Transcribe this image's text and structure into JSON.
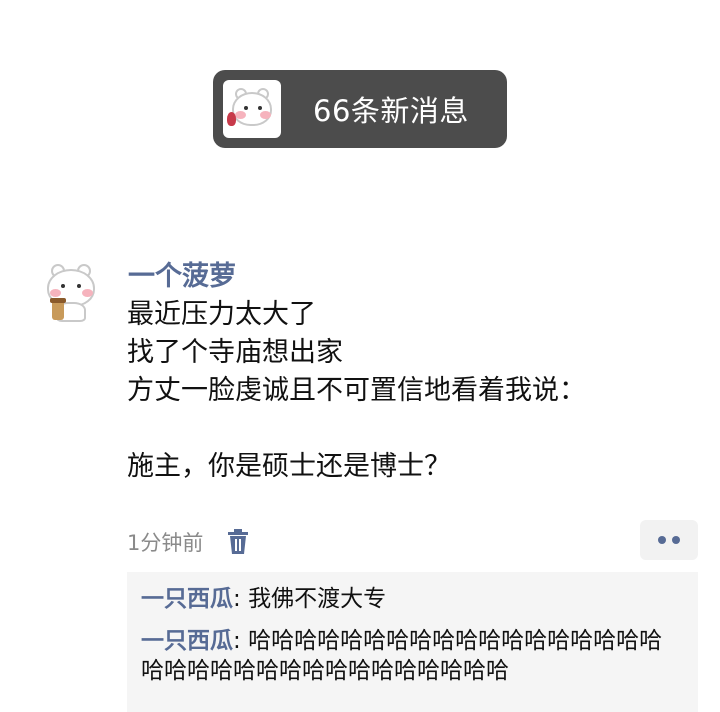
{
  "notification": {
    "text": "66条新消息"
  },
  "post": {
    "username": "一个菠萝",
    "content": "最近压力太大了\n找了个寺庙想出家\n方丈一脸虔诚且不可置信地看着我说：\n\n施主，你是硕士还是博士？",
    "time": "1分钟前",
    "more_icon": "two-dots-icon",
    "delete_icon": "trash-icon"
  },
  "comments": [
    {
      "author": "一只西瓜",
      "separator": ": ",
      "text": "我佛不渡大专"
    },
    {
      "author": "一只西瓜",
      "separator": ": ",
      "text": "哈哈哈哈哈哈哈哈哈哈哈哈哈哈哈哈哈哈哈哈哈哈哈哈哈哈哈哈哈哈哈哈哈哈"
    }
  ],
  "colors": {
    "link_blue": "#576b95",
    "pill_bg": "#4c4c4c",
    "comment_bg": "#f5f5f5"
  }
}
